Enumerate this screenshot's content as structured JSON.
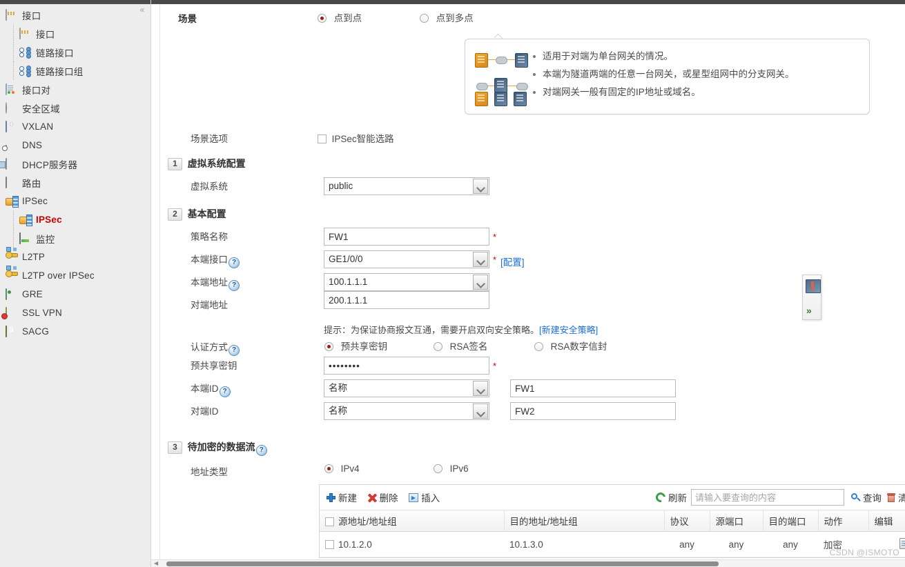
{
  "sidebar": {
    "collapse_glyph": "«",
    "items": [
      {
        "label": "接口",
        "icon": "interface-icon",
        "level": 1,
        "active": false
      },
      {
        "label": "接口",
        "icon": "interface-icon",
        "level": 2,
        "active": false
      },
      {
        "label": "链路接口",
        "icon": "link-interface-icon",
        "level": 2,
        "active": false
      },
      {
        "label": "链路接口组",
        "icon": "link-interface-group-icon",
        "level": 2,
        "active": false
      },
      {
        "label": "接口对",
        "icon": "interface-pair-icon",
        "level": 1,
        "active": false
      },
      {
        "label": "安全区域",
        "icon": "security-zone-icon",
        "level": 1,
        "active": false
      },
      {
        "label": "VXLAN",
        "icon": "vxlan-icon",
        "level": 1,
        "active": false
      },
      {
        "label": "DNS",
        "icon": "dns-icon",
        "level": 1,
        "active": false
      },
      {
        "label": "DHCP服务器",
        "icon": "dhcp-server-icon",
        "level": 1,
        "active": false
      },
      {
        "label": "路由",
        "icon": "route-icon",
        "level": 1,
        "active": false
      },
      {
        "label": "IPSec",
        "icon": "ipsec-icon",
        "level": 1,
        "active": false
      },
      {
        "label": "IPSec",
        "icon": "ipsec-icon",
        "level": 2,
        "active": true
      },
      {
        "label": "监控",
        "icon": "monitor-icon",
        "level": 2,
        "active": false
      },
      {
        "label": "L2TP",
        "icon": "l2tp-key-icon",
        "level": 1,
        "active": false
      },
      {
        "label": "L2TP over IPSec",
        "icon": "l2tp-over-ipsec-icon",
        "level": 1,
        "active": false
      },
      {
        "label": "GRE",
        "icon": "gre-icon",
        "level": 1,
        "active": false
      },
      {
        "label": "SSL VPN",
        "icon": "ssl-vpn-icon",
        "level": 1,
        "active": false
      },
      {
        "label": "SACG",
        "icon": "sacg-shield-icon",
        "level": 1,
        "active": false
      }
    ]
  },
  "scene": {
    "label": "场景",
    "options": [
      {
        "label": "点到点",
        "selected": true
      },
      {
        "label": "点到多点",
        "selected": false
      }
    ],
    "info_bullets": [
      "适用于对端为单台网关的情况。",
      "本端为隧道两端的任意一台网关，或星型组网中的分支网关。",
      "对端网关一般有固定的IP地址或域名。"
    ],
    "option_label": "场景选项",
    "smart_route": {
      "label": "IPSec智能选路",
      "checked": false
    }
  },
  "section1": {
    "number": "1",
    "title": "虚拟系统配置",
    "vsys_label": "虚拟系统",
    "vsys_value": "public"
  },
  "section2": {
    "number": "2",
    "title": "基本配置",
    "policy_name_label": "策略名称",
    "policy_name_value": "FW1",
    "local_iface_label": "本端接口",
    "local_iface_value": "GE1/0/0",
    "config_link": "[配置]",
    "local_addr_label": "本端地址",
    "local_addr_value": "100.1.1.1",
    "peer_addr_label": "对端地址",
    "peer_addr_value": "200.1.1.1",
    "hint_text": "提示：为保证协商报文互通，需要开启双向安全策略。",
    "hint_link": "[新建安全策略]",
    "auth_label": "认证方式",
    "auth_options": [
      {
        "label": "预共享密钥",
        "selected": true
      },
      {
        "label": "RSA签名",
        "selected": false
      },
      {
        "label": "RSA数字信封",
        "selected": false
      }
    ],
    "psk_label": "预共享密钥",
    "psk_value": "••••••••",
    "local_id_label": "本端ID",
    "local_id_type": "名称",
    "local_id_value": "FW1",
    "peer_id_label": "对端ID",
    "peer_id_type": "名称",
    "peer_id_value": "FW2",
    "required_mark": "*"
  },
  "section3": {
    "number": "3",
    "title": "待加密的数据流",
    "addr_type_label": "地址类型",
    "addr_type_options": [
      {
        "label": "IPv4",
        "selected": true
      },
      {
        "label": "IPv6",
        "selected": false
      }
    ],
    "toolbar": {
      "new": "新建",
      "delete": "删除",
      "insert": "插入",
      "refresh": "刷新",
      "query": "查询",
      "clear_query": "清除查询",
      "search_placeholder": "请输入要查询的内容",
      "search_value": ""
    },
    "table": {
      "columns": [
        "源地址/地址组",
        "目的地址/地址组",
        "协议",
        "源端口",
        "目的端口",
        "动作",
        "编辑"
      ],
      "rows": [
        {
          "checked": false,
          "source": "10.1.2.0",
          "destination": "10.1.3.0",
          "protocol": "any",
          "source_port": "any",
          "dest_port": "any",
          "action": "加密",
          "edit_icon": "edit-icon"
        }
      ]
    }
  },
  "right_panel": {
    "chevron": "»",
    "icon": "panel-toggle-icon"
  },
  "watermark": "CSDN @ISMOTO",
  "colors": {
    "accent_link": "#1a6fd4",
    "required": "#cc0000",
    "active_nav": "#cc0000",
    "action_green": "#3a9e46",
    "radio_dot": "#9c1b1b"
  }
}
